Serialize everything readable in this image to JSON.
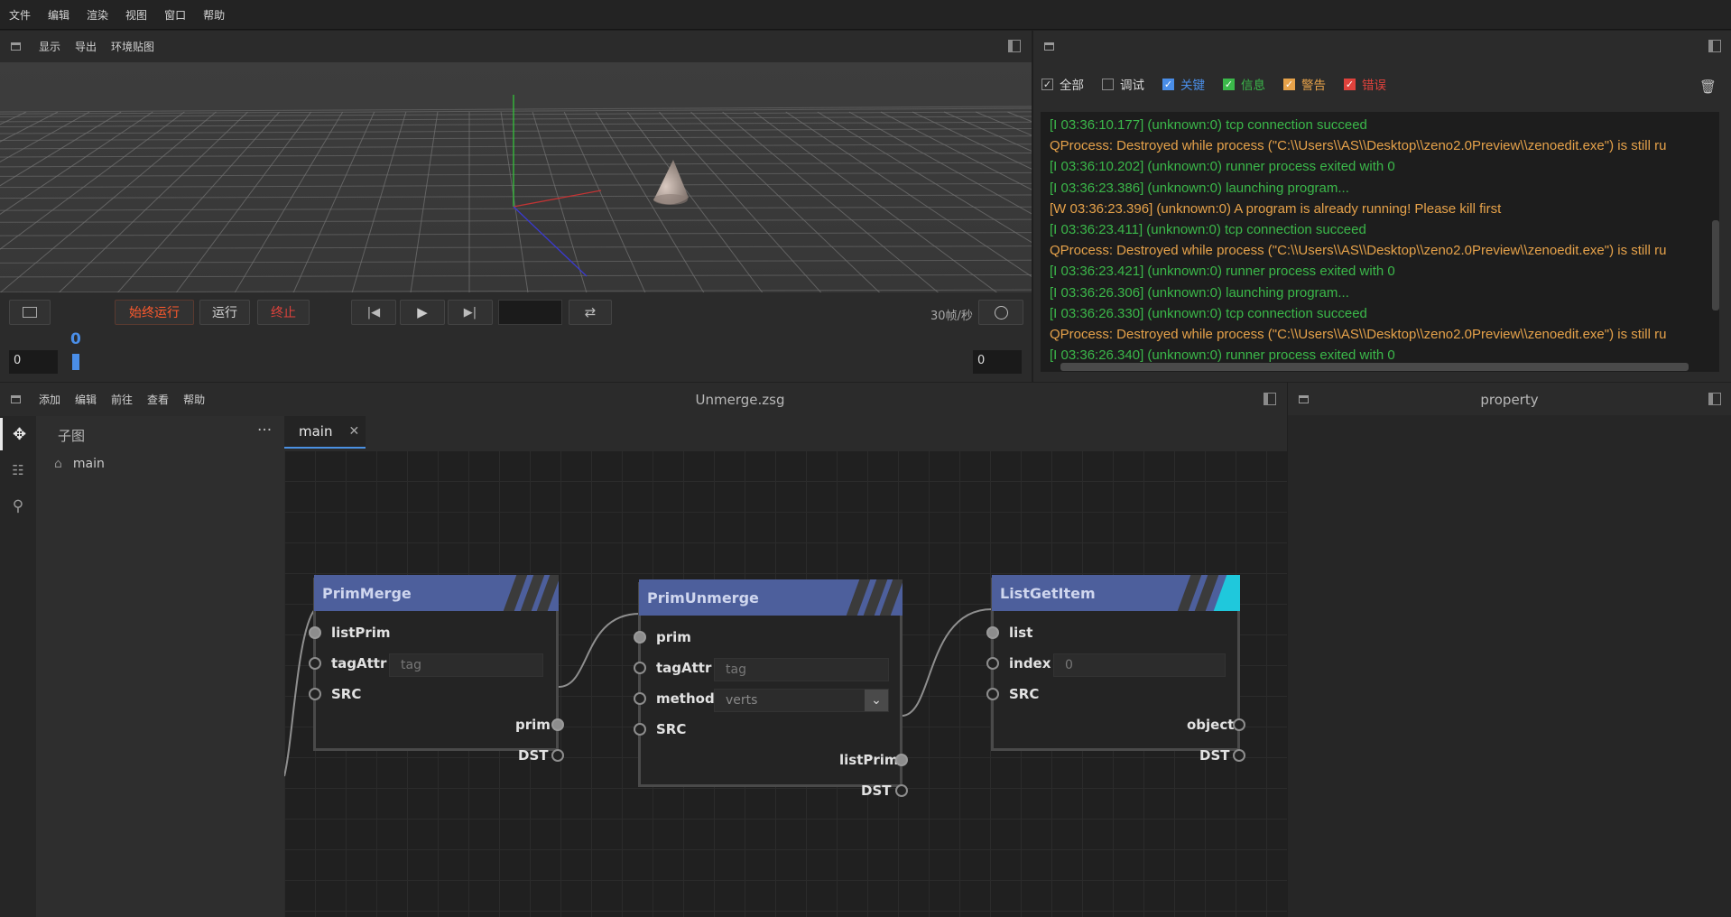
{
  "menubar": {
    "items": [
      "文件",
      "编辑",
      "渲染",
      "视图",
      "窗口",
      "帮助"
    ]
  },
  "viewport": {
    "menu": [
      "显示",
      "导出",
      "环境贴图"
    ],
    "buttons": {
      "always_run": "始终运行",
      "run": "运行",
      "stop": "终止"
    },
    "fps": "30帧/秒",
    "frame_current": "0",
    "frame_start": "0",
    "frame_end": "0",
    "frame_input": ""
  },
  "console": {
    "filters": [
      {
        "label": "全部",
        "checked": true,
        "color": "#d6d6d6"
      },
      {
        "label": "调试",
        "checked": false,
        "color": "#d6d6d6"
      },
      {
        "label": "关键",
        "checked": true,
        "color": "#4a8ee8"
      },
      {
        "label": "信息",
        "checked": true,
        "color": "#3bb84a"
      },
      {
        "label": "警告",
        "checked": true,
        "color": "#e6a24a"
      },
      {
        "label": "错误",
        "checked": true,
        "color": "#e0423c"
      }
    ],
    "logs": [
      {
        "text": "[I 03:36:10.177] (unknown:0) tcp connection succeed",
        "level": "info"
      },
      {
        "text": "QProcess: Destroyed while process (\"C:\\\\Users\\\\AS\\\\Desktop\\\\zeno2.0Preview\\\\zenoedit.exe\") is still ru",
        "level": "warn"
      },
      {
        "text": "[I 03:36:10.202] (unknown:0) runner process exited with 0",
        "level": "info"
      },
      {
        "text": "[I 03:36:23.386] (unknown:0) launching program...",
        "level": "info"
      },
      {
        "text": "[W 03:36:23.396] (unknown:0) A program is already running! Please kill first",
        "level": "warn"
      },
      {
        "text": "[I 03:36:23.411] (unknown:0) tcp connection succeed",
        "level": "info"
      },
      {
        "text": "QProcess: Destroyed while process (\"C:\\\\Users\\\\AS\\\\Desktop\\\\zeno2.0Preview\\\\zenoedit.exe\") is still ru",
        "level": "warn"
      },
      {
        "text": "[I 03:36:23.421] (unknown:0) runner process exited with 0",
        "level": "info"
      },
      {
        "text": "[I 03:36:26.306] (unknown:0) launching program...",
        "level": "info"
      },
      {
        "text": "[I 03:36:26.330] (unknown:0) tcp connection succeed",
        "level": "info"
      },
      {
        "text": "QProcess: Destroyed while process (\"C:\\\\Users\\\\AS\\\\Desktop\\\\zeno2.0Preview\\\\zenoedit.exe\") is still ru",
        "level": "warn"
      },
      {
        "text": "[I 03:36:26.340] (unknown:0) runner process exited with 0",
        "level": "info"
      }
    ]
  },
  "node_editor": {
    "menu": [
      "添加",
      "编辑",
      "前往",
      "查看",
      "帮助"
    ],
    "file_title": "Unmerge.zsg",
    "subgraph_title": "子图",
    "subgraph_item": "main",
    "tab_label": "main",
    "nodes": {
      "primmerge": {
        "title": "PrimMerge",
        "inputs": [
          "listPrim",
          "tagAttr",
          "SRC"
        ],
        "tag_placeholder": "tag",
        "outputs": [
          "prim",
          "DST"
        ]
      },
      "primunmerge": {
        "title": "PrimUnmerge",
        "inputs": [
          "prim",
          "tagAttr",
          "method",
          "SRC"
        ],
        "tag_placeholder": "tag",
        "method_value": "verts",
        "outputs": [
          "listPrim",
          "DST"
        ]
      },
      "listgetitem": {
        "title": "ListGetItem",
        "inputs": [
          "list",
          "index",
          "SRC"
        ],
        "index_value": "0",
        "outputs": [
          "object",
          "DST"
        ]
      }
    }
  },
  "property": {
    "title": "property"
  }
}
